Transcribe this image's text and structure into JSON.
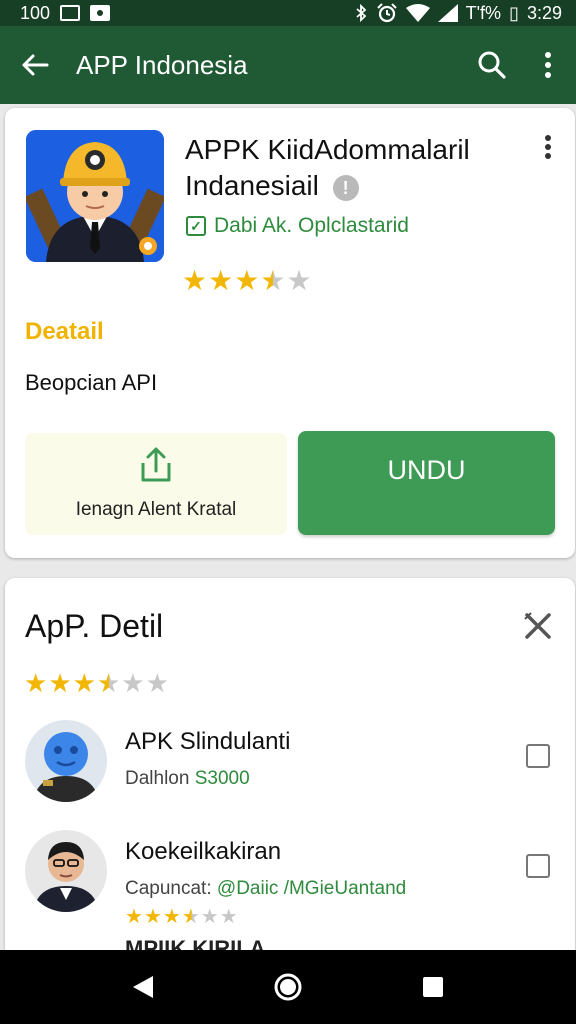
{
  "status_bar": {
    "left_text": "100",
    "right_text": "T'f%",
    "battery_glyph": "▯",
    "time": "3:29",
    "icons": [
      "square-icon",
      "square-filled-icon",
      "bluetooth-icon",
      "alarm-icon",
      "wifi-icon",
      "signal-icon",
      "battery-icon"
    ]
  },
  "app_bar": {
    "title": "APP Indonesia",
    "icons": [
      "back-arrow-icon",
      "search-icon",
      "more-vert-icon"
    ]
  },
  "app_card": {
    "name_line1": "APPK KiidAdommalaril",
    "name_line2": "Indanesiail",
    "info_glyph": "!",
    "developer": "Dabi Ak. Oplclastarid",
    "verified_glyph": "✓",
    "rating": 3.5,
    "detail_heading": "Deatail",
    "detail_text": "Beopcian API",
    "share_label": "Ienagn Alent Kratal",
    "install_label": "UNDU"
  },
  "detail_card": {
    "title": "ApP. Detil",
    "rating": 3.5,
    "items": [
      {
        "title": "APK Slindulanti",
        "sub_prefix": "Dalhlon ",
        "sub_accent": "S3000",
        "rating": null
      },
      {
        "title": "Koekeilkakiran",
        "sub_prefix": "Capuncat: ",
        "sub_accent": "@Daiic /MGieUantand",
        "rating": 3.5
      }
    ],
    "cut_text": "MPIIK KIRILA"
  },
  "colors": {
    "status_bar": "#173f26",
    "app_bar": "#1f5a34",
    "accent_green": "#3d9b56",
    "star": "#f2b705",
    "detail_heading": "#f0b400"
  }
}
